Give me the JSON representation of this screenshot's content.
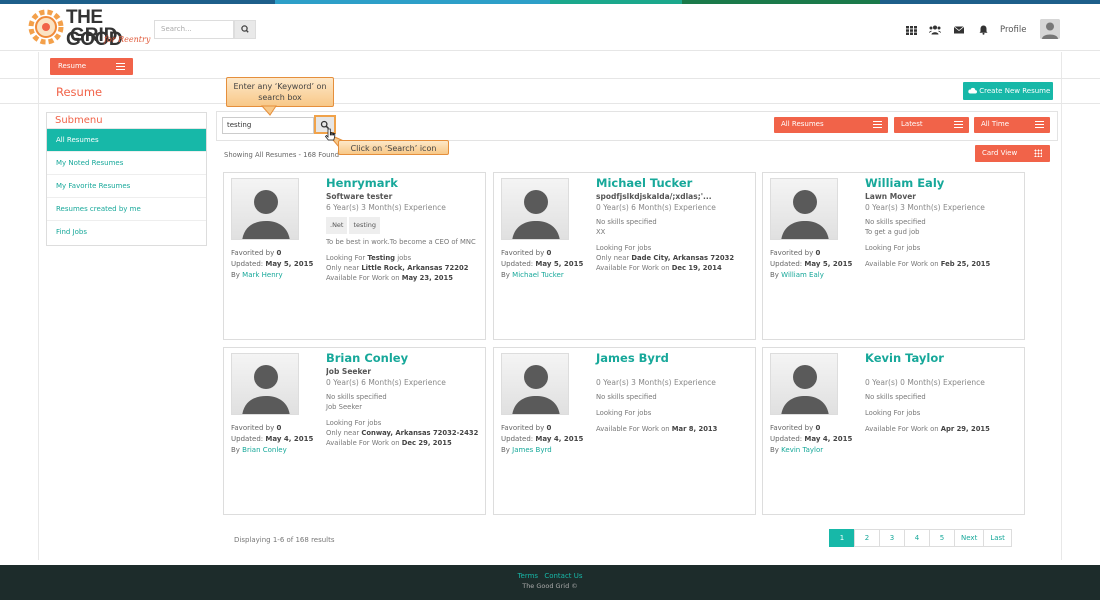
{
  "brand": {
    "name_line1": "THE GOOD",
    "name_line2": "GRID",
    "tagline": "for Reentry"
  },
  "header": {
    "search_placeholder": "Search...",
    "icons": [
      "grid-icon",
      "users-icon",
      "envelope-icon",
      "bell-icon"
    ],
    "profile_label": "Profile"
  },
  "subbar": {
    "tab_label": "Resume"
  },
  "page": {
    "title": "Resume",
    "create_label": "Create New Resume"
  },
  "submenu": {
    "title": "Submenu",
    "items": [
      "All Resumes",
      "My Noted Resumes",
      "My Favorite Resumes",
      "Resumes created by me",
      "Find Jobs"
    ]
  },
  "filters": {
    "search_value": "testing",
    "dropdown1": "All Resumes",
    "dropdown2": "Latest",
    "dropdown3": "All Time",
    "view_label": "Card View"
  },
  "showing_text": "Showing All Resumes - 168 Found",
  "callouts": {
    "keyword": "Enter any ‘Keyword’ on search box",
    "search": "Click on ‘Search’ icon"
  },
  "cards": [
    {
      "name": "Henrymark",
      "title": "Software tester",
      "experience": "6 Year(s) 3 Month(s) Experience",
      "skills": [
        ".Net",
        "testing"
      ],
      "skills_text": "",
      "objective": "To be best in work.To become a CEO of MNC",
      "looking_prefix": "Looking For ",
      "looking_bold": "Testing",
      "looking_suffix": " jobs",
      "near_prefix": "Only near ",
      "near_bold": "Little Rock, Arkansas 72202",
      "avail_prefix": "Available For Work on ",
      "avail_bold": "May 23, 2015",
      "favorited_label": "Favorited by ",
      "favorited_count": "0",
      "updated_label": "Updated: ",
      "updated_date": "May 5, 2015",
      "by_label": "By ",
      "by_name": "Mark Henry"
    },
    {
      "name": "Michael Tucker",
      "title": "spodfjslkdjskalda/;xdlas;'...",
      "experience": "0 Year(s) 6 Month(s) Experience",
      "skills": [],
      "skills_text": "No skills specified",
      "objective": "XX",
      "looking_prefix": "Looking For jobs",
      "looking_bold": "",
      "looking_suffix": "",
      "near_prefix": "Only near ",
      "near_bold": "Dade City, Arkansas 72032",
      "avail_prefix": "Available For Work on ",
      "avail_bold": "Dec 19, 2014",
      "favorited_label": "Favorited by ",
      "favorited_count": "0",
      "updated_label": "Updated: ",
      "updated_date": "May 5, 2015",
      "by_label": "By ",
      "by_name": "Michael Tucker"
    },
    {
      "name": "William Ealy",
      "title": "Lawn Mover",
      "experience": "0 Year(s) 3 Month(s) Experience",
      "skills": [],
      "skills_text": "No skills specified",
      "objective": "To get a gud job",
      "looking_prefix": "Looking For jobs",
      "looking_bold": "",
      "looking_suffix": "",
      "near_prefix": "",
      "near_bold": "",
      "avail_prefix": "Available For Work on ",
      "avail_bold": "Feb 25, 2015",
      "favorited_label": "Favorited by ",
      "favorited_count": "0",
      "updated_label": "Updated: ",
      "updated_date": "May 5, 2015",
      "by_label": "By ",
      "by_name": "William Ealy"
    },
    {
      "name": "Brian Conley",
      "title": "Job Seeker",
      "experience": "0 Year(s) 6 Month(s) Experience",
      "skills": [],
      "skills_text": "No skills specified",
      "objective": "Job Seeker",
      "looking_prefix": "Looking For jobs",
      "looking_bold": "",
      "looking_suffix": "",
      "near_prefix": "Only near ",
      "near_bold": "Conway, Arkansas 72032-2432",
      "avail_prefix": "Available For Work on ",
      "avail_bold": "Dec 29, 2015",
      "favorited_label": "Favorited by ",
      "favorited_count": "0",
      "updated_label": "Updated: ",
      "updated_date": "May 4, 2015",
      "by_label": "By ",
      "by_name": "Brian Conley"
    },
    {
      "name": "James Byrd",
      "title": "",
      "experience": "0 Year(s) 3 Month(s) Experience",
      "skills": [],
      "skills_text": "No skills specified",
      "objective": "",
      "looking_prefix": "Looking For jobs",
      "looking_bold": "",
      "looking_suffix": "",
      "near_prefix": "",
      "near_bold": "",
      "avail_prefix": "Available For Work on ",
      "avail_bold": "Mar 8, 2013",
      "favorited_label": "Favorited by ",
      "favorited_count": "0",
      "updated_label": "Updated: ",
      "updated_date": "May 4, 2015",
      "by_label": "By ",
      "by_name": "James Byrd"
    },
    {
      "name": "Kevin Taylor",
      "title": "",
      "experience": "0 Year(s) 0 Month(s) Experience",
      "skills": [],
      "skills_text": "No skills specified",
      "objective": "",
      "looking_prefix": "Looking For jobs",
      "looking_bold": "",
      "looking_suffix": "",
      "near_prefix": "",
      "near_bold": "",
      "avail_prefix": "Available For Work on ",
      "avail_bold": "Apr 29, 2015",
      "favorited_label": "Favorited by ",
      "favorited_count": "0",
      "updated_label": "Updated: ",
      "updated_date": "May 4, 2015",
      "by_label": "By ",
      "by_name": "Kevin Taylor"
    }
  ],
  "results_text": "Displaying 1-6 of 168 results",
  "pagination": [
    "1",
    "2",
    "3",
    "4",
    "5",
    "Next",
    "Last"
  ],
  "footer": {
    "terms": "Terms",
    "contact": "Contact Us",
    "copyright": "The Good Grid ©"
  },
  "colors": {
    "accent": "#17b8a8",
    "brand_orange": "#f16349",
    "footer_bg": "#1d2c2b"
  }
}
